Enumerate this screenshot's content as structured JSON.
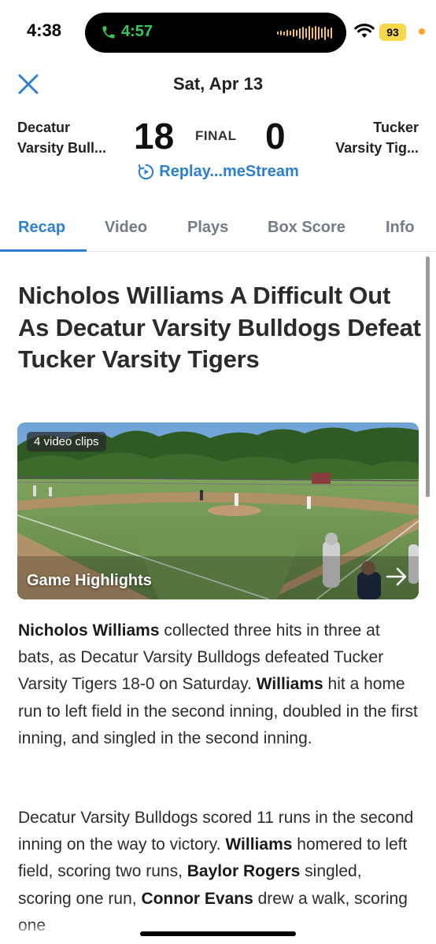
{
  "status_bar": {
    "time": "4:38",
    "call_time": "4:57",
    "battery": "93"
  },
  "header": {
    "date": "Sat, Apr 13"
  },
  "scoreboard": {
    "home_team_line1": "Decatur",
    "home_team_line2": "Varsity Bull...",
    "home_score": "18",
    "status": "FINAL",
    "away_score": "0",
    "away_team_line1": "Tucker",
    "away_team_line2": "Varsity Tig...",
    "replay_label": "Replay...meStream"
  },
  "tabs": [
    "Recap",
    "Video",
    "Plays",
    "Box Score",
    "Info"
  ],
  "article": {
    "headline": "Nicholos Williams A Difficult Out As Decatur Varsity Bulldogs Defeat Tucker Varsity Tigers",
    "video": {
      "clips_badge": "4 video clips",
      "title": "Game Highlights"
    },
    "p1": {
      "name1": "Nicholos Williams",
      "text1": " collected three hits in three at bats, as Decatur Varsity Bulldogs defeated Tucker Varsity Tigers 18-0 on Saturday. ",
      "name2": "Williams",
      "text2": " hit a home run to left field in the second inning, doubled in the first inning, and singled in the second inning."
    },
    "p2": {
      "text1": "Decatur Varsity Bulldogs scored 11 runs in the second inning on the way to victory. ",
      "name1": "Williams",
      "text2": " homered to left field, scoring two runs, ",
      "name2": "Baylor Rogers",
      "text3": " singled, scoring one run, ",
      "name3": "Connor Evans",
      "text4": " drew a walk, scoring one"
    }
  },
  "colors": {
    "accent": "#2d7fd4",
    "tab_inactive": "#737b86",
    "call_green": "#34c759",
    "battery_yellow": "#f7d84a"
  }
}
